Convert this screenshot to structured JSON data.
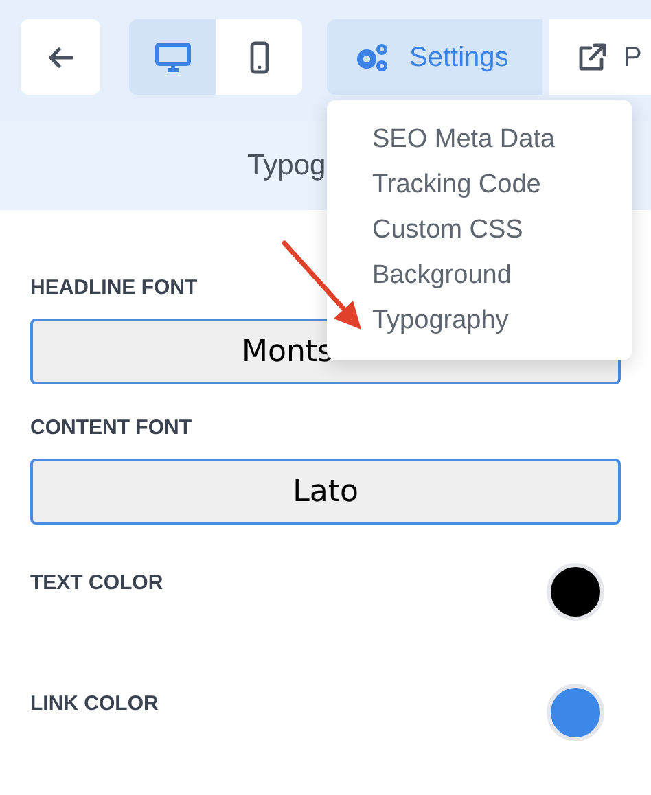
{
  "toolbar": {
    "view_modes": [
      {
        "kind": "desktop",
        "selected": true
      },
      {
        "kind": "mobile",
        "selected": false
      }
    ],
    "settings_button": {
      "label": "Settings"
    },
    "preview_button": {
      "label": "P"
    }
  },
  "panel_title": "Typog",
  "settings_menu": {
    "items": [
      {
        "label": "SEO Meta Data"
      },
      {
        "label": "Tracking Code"
      },
      {
        "label": "Custom CSS"
      },
      {
        "label": "Background"
      },
      {
        "label": "Typography"
      }
    ]
  },
  "fonts": [
    {
      "label": "HEADLINE FONT",
      "value": "Monts",
      "partly_hidden": true
    },
    {
      "label": "CONTENT FONT",
      "value": "Lato"
    }
  ],
  "colors": [
    {
      "label": "TEXT COLOR",
      "color": "#000000"
    },
    {
      "label": "LINK COLOR",
      "color": "#3b88e8"
    }
  ]
}
